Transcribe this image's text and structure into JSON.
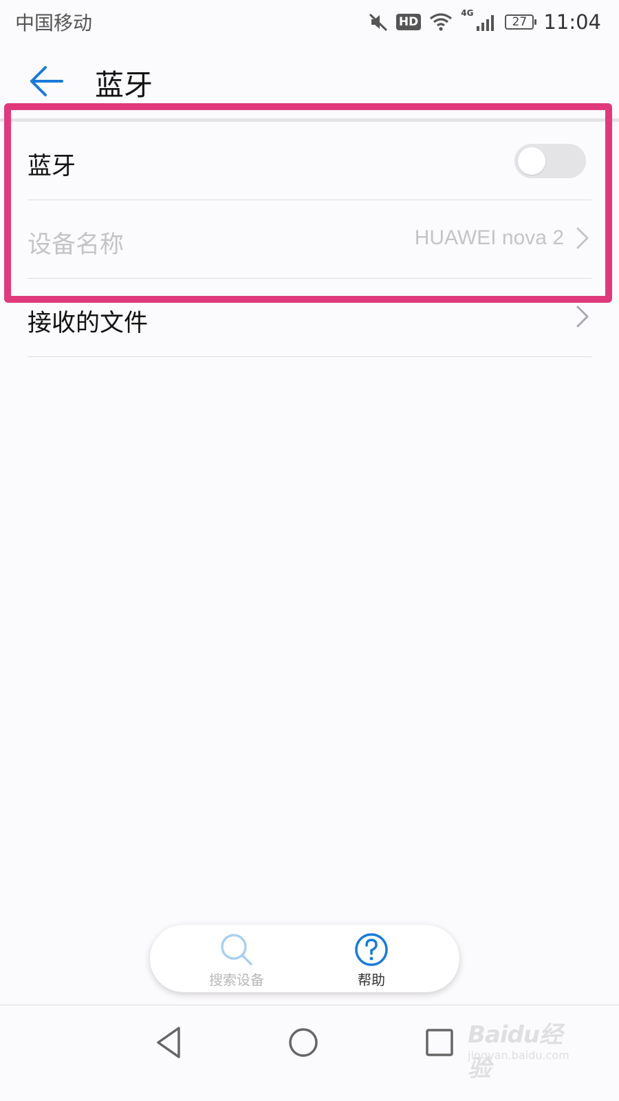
{
  "status_bar": {
    "carrier": "中国移动",
    "hd_badge": "HD",
    "network": "4G",
    "battery": "27",
    "time": "11:04",
    "icons": [
      "mute-icon",
      "hd-icon",
      "wifi-icon",
      "signal-icon",
      "battery-icon"
    ]
  },
  "header": {
    "title": "蓝牙",
    "back_icon": "back-arrow-icon",
    "accent_color": "#1a7ad9"
  },
  "settings": {
    "rows": [
      {
        "label": "蓝牙",
        "control": "toggle",
        "toggle_on": false
      },
      {
        "label": "设备名称",
        "value": "HUAWEI nova 2",
        "disabled": true,
        "icon": "chevron-right-icon"
      },
      {
        "label": "接收的文件",
        "icon": "chevron-right-icon"
      }
    ]
  },
  "annotation": {
    "highlight_color": "#e03a7d"
  },
  "action_bar": {
    "search": {
      "label": "搜索设备",
      "icon": "search-icon",
      "enabled": false
    },
    "help": {
      "label": "帮助",
      "icon": "help-icon"
    }
  },
  "nav_bar": {
    "icons": [
      "nav-back-icon",
      "nav-home-icon",
      "nav-recent-icon"
    ]
  },
  "watermark": {
    "text": "Baidu经验",
    "sub": "jingyan.baidu.com"
  }
}
